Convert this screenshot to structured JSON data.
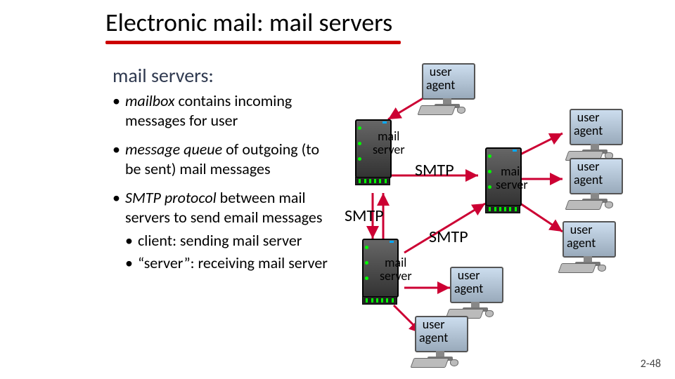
{
  "title": "Electronic mail: mail servers",
  "subtitle": "mail servers:",
  "bullets": {
    "b1_pre": "mailbox",
    "b1_post": " contains incoming messages for user",
    "b2_pre": "message queue",
    "b2_post": " of outgoing (to be sent) mail messages",
    "b3_pre": "SMTP protocol",
    "b3_post": " between mail servers to send email messages",
    "b3a": "client: sending mail server",
    "b3b": "“server”: receiving mail server"
  },
  "diagram": {
    "user_agent": "user\nagent",
    "mail_server": "mail\nserver",
    "smtp": "SMTP"
  },
  "pagenum": "2-48"
}
